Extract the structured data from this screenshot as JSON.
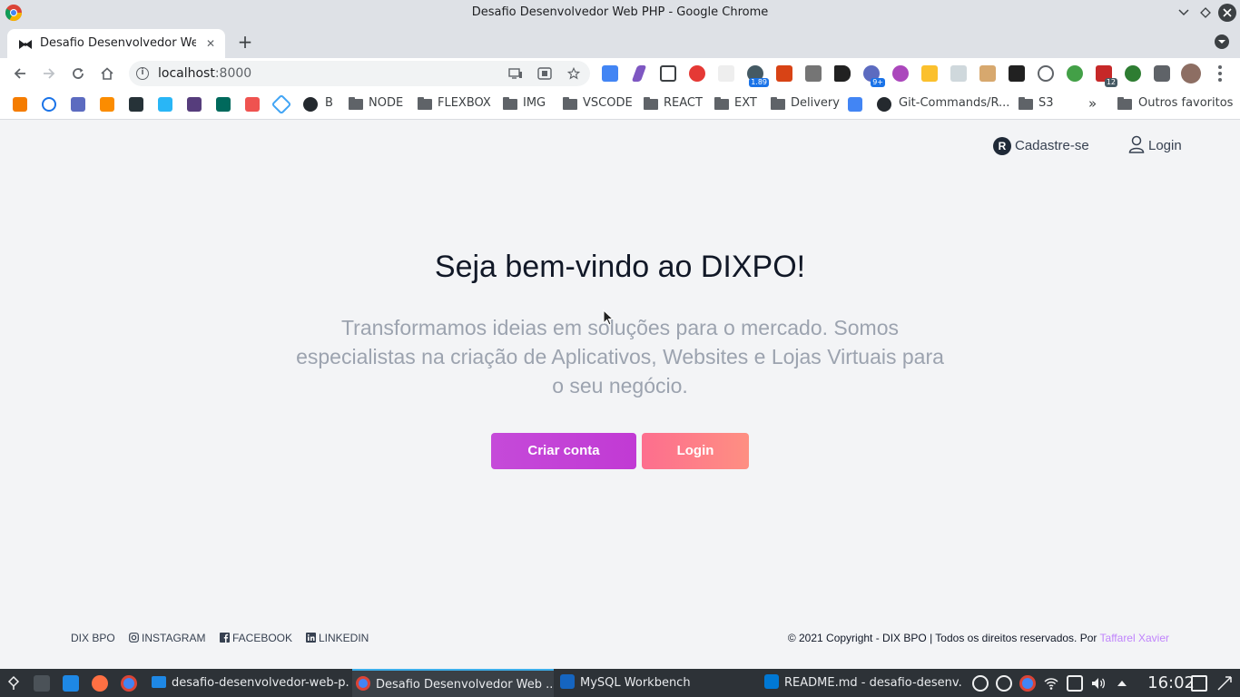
{
  "window": {
    "title": "Desafio Desenvolvedor Web PHP - Google Chrome"
  },
  "tab": {
    "title": "Desafio Desenvolvedor Web PHP",
    "close": "✕",
    "new_tab": "+"
  },
  "toolbar": {
    "url_host": "localhost",
    "url_port": ":8000"
  },
  "bookmarks": {
    "items": [
      {
        "label": "B"
      },
      {
        "label": "NODE"
      },
      {
        "label": "FLEXBOX"
      },
      {
        "label": "IMG"
      },
      {
        "label": "VSCODE"
      },
      {
        "label": "REACT"
      },
      {
        "label": "EXT"
      },
      {
        "label": "Delivery"
      },
      {
        "label": "Git-Commands/R..."
      },
      {
        "label": "S3"
      }
    ],
    "overflow": "»",
    "other": "Outros favoritos"
  },
  "page": {
    "nav": {
      "register_icon_letter": "R",
      "register": "Cadastre-se",
      "login": "Login"
    },
    "hero": {
      "title": "Seja bem-vindo ao DIXPO!",
      "subtitle": "Transformamos ideias em soluções para o mercado. Somos especialistas na criação de Aplicativos, Websites e Lojas Virtuais para o seu negócio."
    },
    "buttons": {
      "create": "Criar conta",
      "login": "Login"
    },
    "footer": {
      "brand": "DIX BPO",
      "instagram": "INSTAGRAM",
      "facebook": "FACEBOOK",
      "linkedin": "LINKEDIN",
      "copyright": "© 2021 Copyright - DIX BPO | Todos os direitos reservados. Por ",
      "author": "Taffarel Xavier"
    }
  },
  "taskbar": {
    "tasks": [
      {
        "label": "desafio-desenvolvedor-web-p..."
      },
      {
        "label": "Desafio Desenvolvedor Web ..."
      },
      {
        "label": "MySQL Workbench"
      },
      {
        "label": "README.md - desafio-desenv..."
      }
    ],
    "clock": "16:02"
  },
  "extensions": {
    "badge_a": "1.89",
    "badge_b": "9+",
    "badge_c": "12"
  },
  "colors": {
    "primary_button": "#c54ad9",
    "secondary_button": "#fd7a88",
    "author_link": "#c084fc",
    "page_bg": "#f3f4f6"
  }
}
